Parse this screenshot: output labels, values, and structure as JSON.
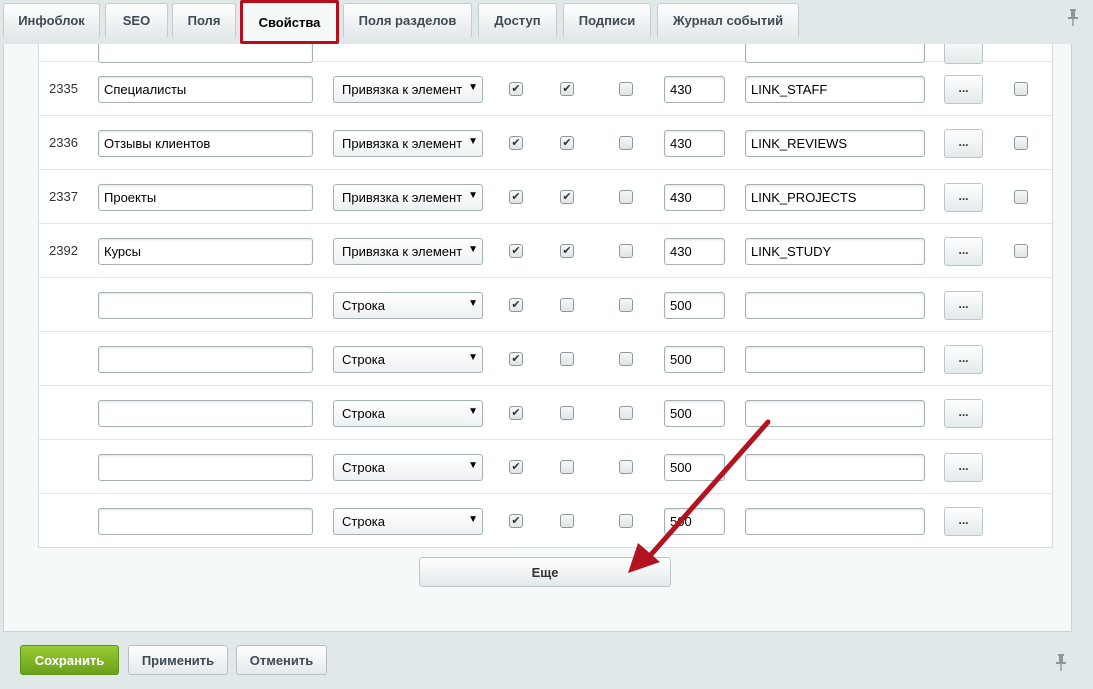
{
  "tabs": [
    {
      "label": "Инфоблок"
    },
    {
      "label": "SEO"
    },
    {
      "label": "Поля"
    },
    {
      "label": "Свойства"
    },
    {
      "label": "Поля разделов"
    },
    {
      "label": "Доступ"
    },
    {
      "label": "Подписи"
    },
    {
      "label": "Журнал событий"
    }
  ],
  "active_tab": "Свойства",
  "rows": [
    {
      "id": "2335",
      "name": "Специалисты",
      "type": "Привязка к элемент",
      "checks": [
        true,
        true,
        false
      ],
      "sort": "430",
      "code": "LINK_STAFF",
      "extra_check": false
    },
    {
      "id": "2336",
      "name": "Отзывы клиентов",
      "type": "Привязка к элемент",
      "checks": [
        true,
        true,
        false
      ],
      "sort": "430",
      "code": "LINK_REVIEWS",
      "extra_check": false
    },
    {
      "id": "2337",
      "name": "Проекты",
      "type": "Привязка к элемент",
      "checks": [
        true,
        true,
        false
      ],
      "sort": "430",
      "code": "LINK_PROJECTS",
      "extra_check": false
    },
    {
      "id": "2392",
      "name": "Курсы",
      "type": "Привязка к элемент",
      "checks": [
        true,
        true,
        false
      ],
      "sort": "430",
      "code": "LINK_STUDY",
      "extra_check": false
    },
    {
      "id": "",
      "name": "",
      "type": "Строка",
      "checks": [
        true,
        false,
        false
      ],
      "sort": "500",
      "code": ""
    },
    {
      "id": "",
      "name": "",
      "type": "Строка",
      "checks": [
        true,
        false,
        false
      ],
      "sort": "500",
      "code": ""
    },
    {
      "id": "",
      "name": "",
      "type": "Строка",
      "checks": [
        true,
        false,
        false
      ],
      "sort": "500",
      "code": ""
    },
    {
      "id": "",
      "name": "",
      "type": "Строка",
      "checks": [
        true,
        false,
        false
      ],
      "sort": "500",
      "code": ""
    },
    {
      "id": "",
      "name": "",
      "type": "Строка",
      "checks": [
        true,
        false,
        false
      ],
      "sort": "500",
      "code": ""
    }
  ],
  "dots_label": "...",
  "select_arrow": "▼",
  "check_mark": "✔",
  "more_button": "Еще",
  "footer": {
    "save": "Сохранить",
    "apply": "Применить",
    "cancel": "Отменить"
  },
  "colors": {
    "active_tab_outline": "#b70e1c",
    "annotation_arrow": "#b3121f",
    "save_button": "#7eb424"
  },
  "icons": {
    "pin": "pin-icon",
    "annotation": "arrow-annotation"
  }
}
